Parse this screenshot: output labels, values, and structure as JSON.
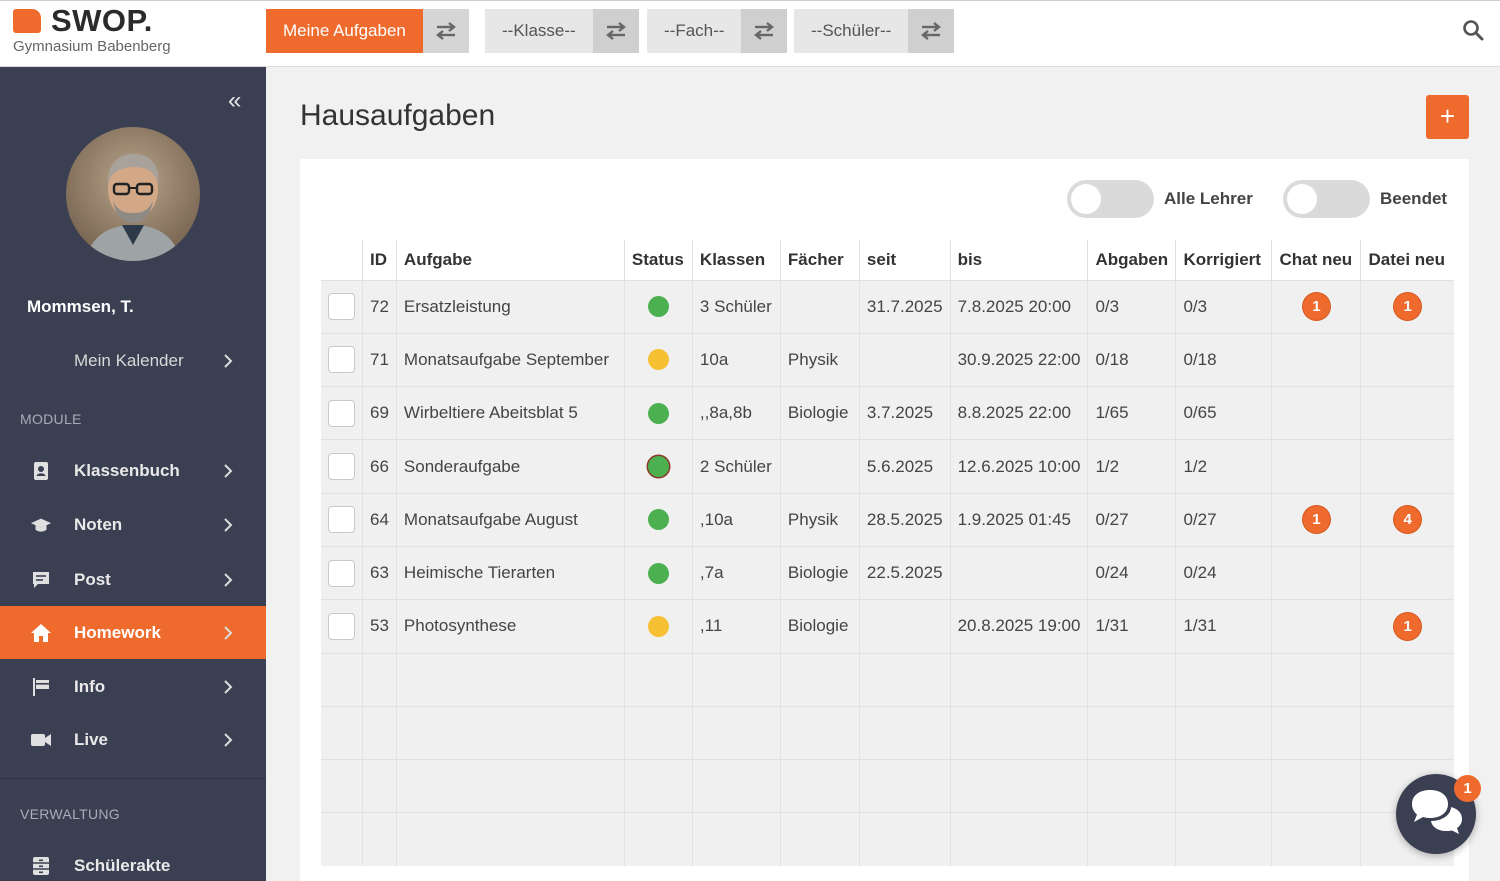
{
  "brand": {
    "name": "SWOP.",
    "school": "Gymnasium Babenberg",
    "accent": "#ee6a2d",
    "sidebar_bg": "#3a3f51"
  },
  "topbar": {
    "selectors": [
      {
        "label": "Meine Aufgaben",
        "active": true
      },
      {
        "label": "--Klasse--",
        "active": false
      },
      {
        "label": "--Fach--",
        "active": false
      },
      {
        "label": "--Schüler--",
        "active": false
      }
    ],
    "search_icon": "search-icon",
    "switch_icon": "swap-arrows-icon"
  },
  "sidebar": {
    "user": "Mommsen, T.",
    "calendar": "Mein Kalender",
    "section_modules": "MODULE",
    "items": [
      {
        "label": "Klassenbuch",
        "icon": "address-book-icon"
      },
      {
        "label": "Noten",
        "icon": "graduation-cap-icon"
      },
      {
        "label": "Post",
        "icon": "message-icon"
      },
      {
        "label": "Homework",
        "icon": "home-icon",
        "active": true
      },
      {
        "label": "Info",
        "icon": "flag-icon"
      },
      {
        "label": "Live",
        "icon": "video-camera-icon"
      }
    ],
    "section_admin": "VERWALTUNG",
    "admin_items": [
      {
        "label": "Schülerakte",
        "icon": "archive-icon"
      }
    ]
  },
  "main": {
    "title": "Hausaufgaben",
    "add_label": "+",
    "toggles": [
      {
        "label": "Alle Lehrer",
        "on": false
      },
      {
        "label": "Beendet",
        "on": false
      }
    ],
    "columns": [
      "",
      "ID",
      "Aufgabe",
      "Status",
      "Klassen",
      "Fächer",
      "seit",
      "bis",
      "Abgaben",
      "Korrigiert",
      "Chat neu",
      "Datei neu"
    ],
    "rows": [
      {
        "id": "72",
        "task": "Ersatzleistung",
        "status": "#4caf50",
        "status_ring": false,
        "classes": "3 Schüler",
        "subject": "",
        "since": "31.7.2025",
        "until": "7.8.2025 20:00",
        "submitted": "0/3",
        "corrected": "0/3",
        "chat": "1",
        "file": "1"
      },
      {
        "id": "71",
        "task": "Monatsaufgabe September",
        "status": "#f6c033",
        "status_ring": false,
        "classes": "10a",
        "subject": "Physik",
        "since": "",
        "until": "30.9.2025 22:00",
        "submitted": "0/18",
        "corrected": "0/18",
        "chat": "",
        "file": ""
      },
      {
        "id": "69",
        "task": "Wirbeltiere Abeitsblat 5",
        "status": "#4caf50",
        "status_ring": false,
        "classes": ",,8a,8b",
        "subject": "Biologie",
        "since": "3.7.2025",
        "until": "8.8.2025 22:00",
        "submitted": "1/65",
        "corrected": "0/65",
        "chat": "",
        "file": ""
      },
      {
        "id": "66",
        "task": "Sonderaufgabe",
        "status": "#4caf50",
        "status_ring": true,
        "classes": "2 Schüler",
        "subject": "",
        "since": "5.6.2025",
        "until": "12.6.2025 10:00",
        "submitted": "1/2",
        "corrected": "1/2",
        "chat": "",
        "file": ""
      },
      {
        "id": "64",
        "task": "Monatsaufgabe August",
        "status": "#4caf50",
        "status_ring": false,
        "classes": ",10a",
        "subject": "Physik",
        "since": "28.5.2025",
        "until": "1.9.2025 01:45",
        "submitted": "0/27",
        "corrected": "0/27",
        "chat": "1",
        "file": "4"
      },
      {
        "id": "63",
        "task": "Heimische Tierarten",
        "status": "#4caf50",
        "status_ring": false,
        "classes": ",7a",
        "subject": "Biologie",
        "since": "22.5.2025",
        "until": "",
        "submitted": "0/24",
        "corrected": "0/24",
        "chat": "",
        "file": ""
      },
      {
        "id": "53",
        "task": "Photosynthese",
        "status": "#f6c033",
        "status_ring": false,
        "classes": ",11",
        "subject": "Biologie",
        "since": "",
        "until": "20.8.2025 19:00",
        "submitted": "1/31",
        "corrected": "1/31",
        "chat": "",
        "file": "1"
      }
    ],
    "empty_rows": 4
  },
  "chat_widget": {
    "badge": "1",
    "icon": "chat-bubbles-icon"
  }
}
